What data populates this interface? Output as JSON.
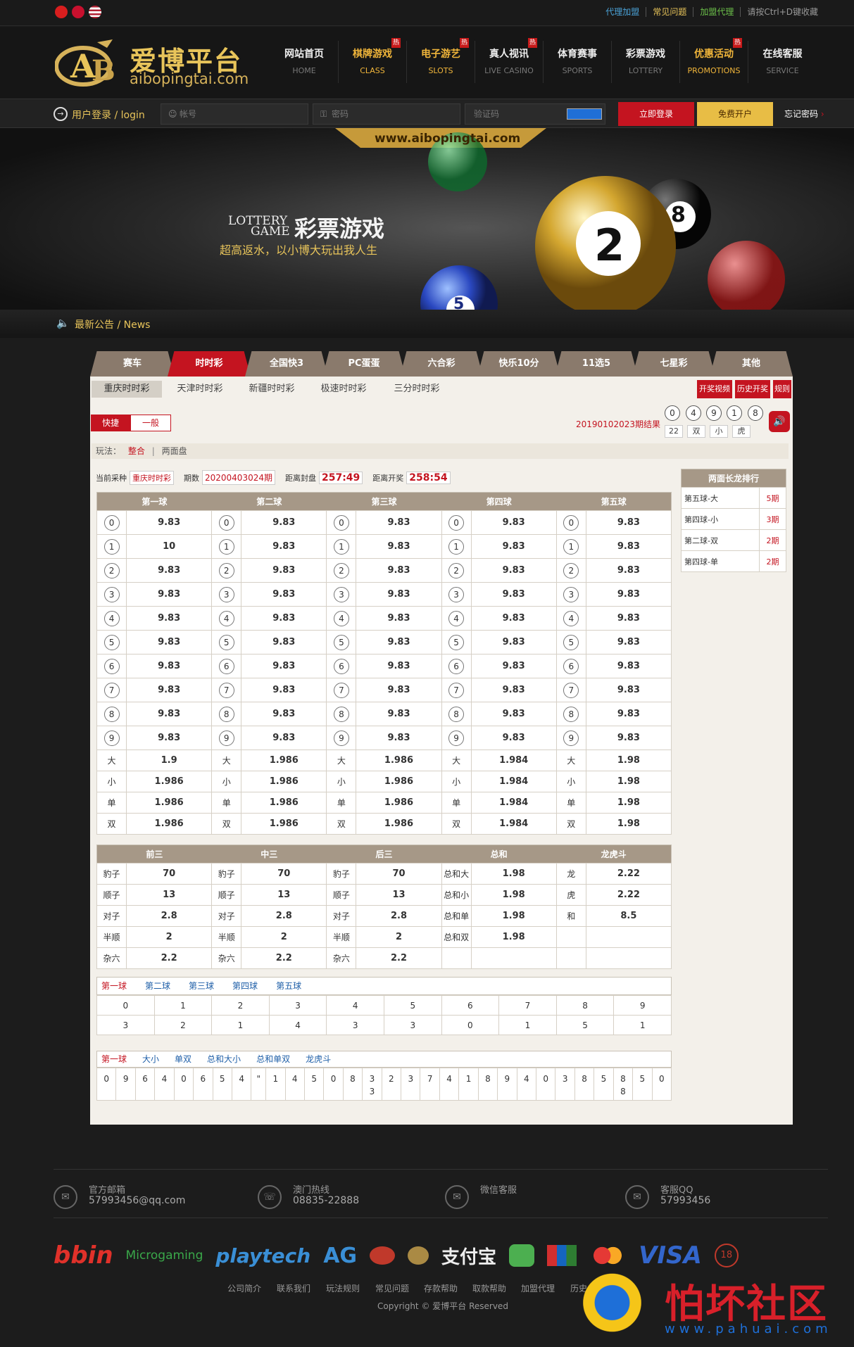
{
  "topbar": {
    "links": [
      "代理加盟",
      "常见问题",
      "加盟代理",
      "请按Ctrl+D键收藏"
    ]
  },
  "header": {
    "logo_cn": "爱博平台",
    "logo_en": "aibopingtai.com",
    "nav": [
      {
        "cn": "网站首页",
        "en": "HOME"
      },
      {
        "cn": "棋牌游戏",
        "en": "CLASS",
        "badge": "热"
      },
      {
        "cn": "电子游艺",
        "en": "SLOTS",
        "badge": "热"
      },
      {
        "cn": "真人视讯",
        "en": "LIVE CASINO",
        "badge": "热"
      },
      {
        "cn": "体育赛事",
        "en": "SPORTS"
      },
      {
        "cn": "彩票游戏",
        "en": "LOTTERY"
      },
      {
        "cn": "优惠活动",
        "en": "PROMOTIONS",
        "badge": "热"
      },
      {
        "cn": "在线客服",
        "en": "SERVICE"
      }
    ]
  },
  "login": {
    "title": "用户登录 / login",
    "account_placeholder": "帐号",
    "password_placeholder": "密码",
    "captcha_placeholder": "验证码",
    "login_btn": "立即登录",
    "register_btn": "免费开户",
    "forgot": "忘记密码"
  },
  "banner": {
    "url": "www.aibopingtai.com",
    "lottery_en1": "LOTTERY",
    "lottery_en2": "GAME",
    "lottery_cn": "彩票游戏",
    "slogan": "超高返水，以小博大玩出我人生",
    "balls": [
      "2",
      "8",
      "5"
    ]
  },
  "news": {
    "label": "最新公告 / News"
  },
  "tabs": [
    "赛车",
    "时时彩",
    "全国快3",
    "PC蛋蛋",
    "六合彩",
    "快乐10分",
    "11选5",
    "七星彩",
    "其他"
  ],
  "subtabs": [
    "重庆时时彩",
    "天津时时彩",
    "新疆时时彩",
    "极速时时彩",
    "三分时时彩"
  ],
  "right_buttons": [
    "开奖视频",
    "历史开奖",
    "规则"
  ],
  "mode": {
    "fast": "快捷",
    "normal": "一般"
  },
  "result": {
    "period_label": "20190102023期结果",
    "balls": [
      "0",
      "4",
      "9",
      "1",
      "8"
    ],
    "stats": [
      "22",
      "双",
      "小",
      "虎"
    ]
  },
  "play": {
    "label": "玩法：",
    "items": [
      "整合",
      "两面盘"
    ]
  },
  "status": {
    "current_label": "当前采种",
    "current_value": "重庆时时彩",
    "period_label": "期数",
    "period_value": "20200403024期",
    "close_label": "距离封盘",
    "close_value": "257:49",
    "open_label": "距离开奖",
    "open_value": "258:54"
  },
  "balls_table": {
    "headers": [
      "第一球",
      "第二球",
      "第三球",
      "第四球",
      "第五球"
    ],
    "digits": [
      "0",
      "1",
      "2",
      "3",
      "4",
      "5",
      "6",
      "7",
      "8",
      "9"
    ],
    "odds": [
      [
        "9.83",
        "10",
        "9.83",
        "9.83",
        "9.83",
        "9.83",
        "9.83",
        "9.83",
        "9.83",
        "9.83"
      ],
      [
        "9.83",
        "9.83",
        "9.83",
        "9.83",
        "9.83",
        "9.83",
        "9.83",
        "9.83",
        "9.83",
        "9.83"
      ],
      [
        "9.83",
        "9.83",
        "9.83",
        "9.83",
        "9.83",
        "9.83",
        "9.83",
        "9.83",
        "9.83",
        "9.83"
      ],
      [
        "9.83",
        "9.83",
        "9.83",
        "9.83",
        "9.83",
        "9.83",
        "9.83",
        "9.83",
        "9.83",
        "9.83"
      ],
      [
        "9.83",
        "9.83",
        "9.83",
        "9.83",
        "9.83",
        "9.83",
        "9.83",
        "9.83",
        "9.83",
        "9.83"
      ]
    ],
    "bs_labels": [
      "大",
      "小",
      "单",
      "双"
    ],
    "bs_odds": [
      [
        "1.9",
        "1.986",
        "1.986",
        "1.986"
      ],
      [
        "1.986",
        "1.986",
        "1.986",
        "1.986"
      ],
      [
        "1.986",
        "1.986",
        "1.986",
        "1.986"
      ],
      [
        "1.984",
        "1.984",
        "1.984",
        "1.984"
      ],
      [
        "1.98",
        "1.98",
        "1.98",
        "1.98"
      ]
    ]
  },
  "combo_table": {
    "headers": [
      "前三",
      "中三",
      "后三",
      "总和",
      "龙虎斗"
    ],
    "rows": [
      [
        "豹子",
        "70",
        "豹子",
        "70",
        "豹子",
        "70",
        "总和大",
        "1.98",
        "龙",
        "2.22"
      ],
      [
        "顺子",
        "13",
        "顺子",
        "13",
        "顺子",
        "13",
        "总和小",
        "1.98",
        "虎",
        "2.22"
      ],
      [
        "对子",
        "2.8",
        "对子",
        "2.8",
        "对子",
        "2.8",
        "总和单",
        "1.98",
        "和",
        "8.5"
      ],
      [
        "半顺",
        "2",
        "半顺",
        "2",
        "半顺",
        "2",
        "总和双",
        "1.98",
        "",
        ""
      ],
      [
        "杂六",
        "2.2",
        "杂六",
        "2.2",
        "杂六",
        "2.2",
        "",
        "",
        "",
        ""
      ]
    ]
  },
  "stat_tabs": [
    "第一球",
    "第二球",
    "第三球",
    "第四球",
    "第五球"
  ],
  "stat_table": {
    "row1": [
      "0",
      "1",
      "2",
      "3",
      "4",
      "5",
      "6",
      "7",
      "8",
      "9"
    ],
    "row2": [
      "3",
      "2",
      "1",
      "4",
      "3",
      "3",
      "0",
      "1",
      "5",
      "1"
    ]
  },
  "trend_tabs": [
    "第一球",
    "大小",
    "单双",
    "总和大小",
    "总和单双",
    "龙虎斗"
  ],
  "trend_row": [
    "0",
    "9",
    "6",
    "4",
    "0",
    "6",
    "5",
    "4",
    "\"",
    "1",
    "4",
    "5",
    "0",
    "8",
    "3",
    "2",
    "3",
    "7",
    "4",
    "1",
    "8",
    "9",
    "4",
    "0",
    "3",
    "8",
    "5",
    "8",
    "5",
    "0"
  ],
  "trend_sub": {
    "14": "3",
    "27": "8"
  },
  "long_dragon": {
    "title": "两面长龙排行",
    "rows": [
      {
        "name": "第五球-大",
        "value": "5期"
      },
      {
        "name": "第四球-小",
        "value": "3期"
      },
      {
        "name": "第二球-双",
        "value": "2期"
      },
      {
        "name": "第四球-单",
        "value": "2期"
      }
    ]
  },
  "footer": {
    "contacts": [
      {
        "title": "官方邮箱",
        "value": "57993456@qq.com"
      },
      {
        "title": "澳门热线",
        "value": "08835-22888"
      },
      {
        "title": "微信客服",
        "value": ""
      },
      {
        "title": "客服QQ",
        "value": "57993456"
      }
    ],
    "partners": [
      "bbin",
      "Microgaming",
      "playtech",
      "AG",
      "支付宝",
      "VISA",
      "18"
    ],
    "links": [
      "公司简介",
      "联系我们",
      "玩法规则",
      "常见问题",
      "存款帮助",
      "取款帮助",
      "加盟代理",
      "历史"
    ],
    "copyright": "Copyright © 爱博平台 Reserved",
    "watermark_cn": "怕坏社区",
    "watermark_en": "www.pahuai.com"
  },
  "colors": {
    "accent_red": "#c41420",
    "gold": "#e8c45a",
    "table_header": "#a69887"
  }
}
